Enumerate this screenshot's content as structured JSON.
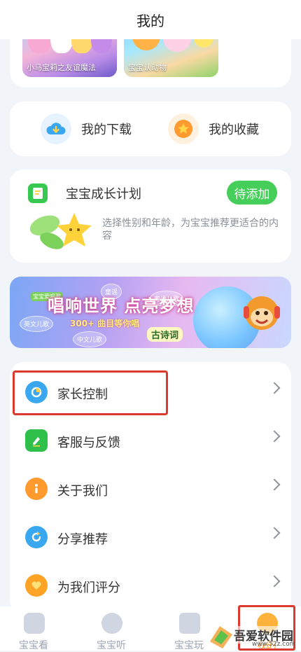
{
  "header": {
    "title": "我的"
  },
  "recent": [
    {
      "caption": "小马宝莉之友谊魔法"
    },
    {
      "caption": "宝宝认动物"
    }
  ],
  "quick_actions": {
    "download": "我的下载",
    "favorites": "我的收藏"
  },
  "growth_plan": {
    "title": "宝宝成长计划",
    "badge": "待添加",
    "description": "选择性别和年龄，为宝宝推荐更适合的内容"
  },
  "banner": {
    "label": "宝宝爱唱歌",
    "title": "唱响世界 点亮梦想",
    "subtitle": "300+ 曲目等你唱",
    "tags": [
      "童谣",
      "粤语儿歌",
      "英文儿歌",
      "中文儿歌"
    ],
    "poem": "古诗词"
  },
  "menu": [
    {
      "label": "家长控制",
      "icon": "parental-control-icon",
      "color": "#3aa8f0"
    },
    {
      "label": "客服与反馈",
      "icon": "feedback-icon",
      "color": "#2fc04c"
    },
    {
      "label": "关于我们",
      "icon": "info-icon",
      "color": "#ff9a2e"
    },
    {
      "label": "分享推荐",
      "icon": "share-icon",
      "color": "#3aa8f0"
    },
    {
      "label": "为我们评分",
      "icon": "heart-icon",
      "color": "#ffa326"
    }
  ],
  "tabbar": {
    "items": [
      {
        "label": "宝宝看"
      },
      {
        "label": "宝宝听"
      },
      {
        "label": "宝宝玩"
      },
      {
        "label": ""
      },
      {
        "label": "我的"
      }
    ]
  },
  "watermark": {
    "text": "吾爱软件园",
    "url": "www.52z.com"
  }
}
